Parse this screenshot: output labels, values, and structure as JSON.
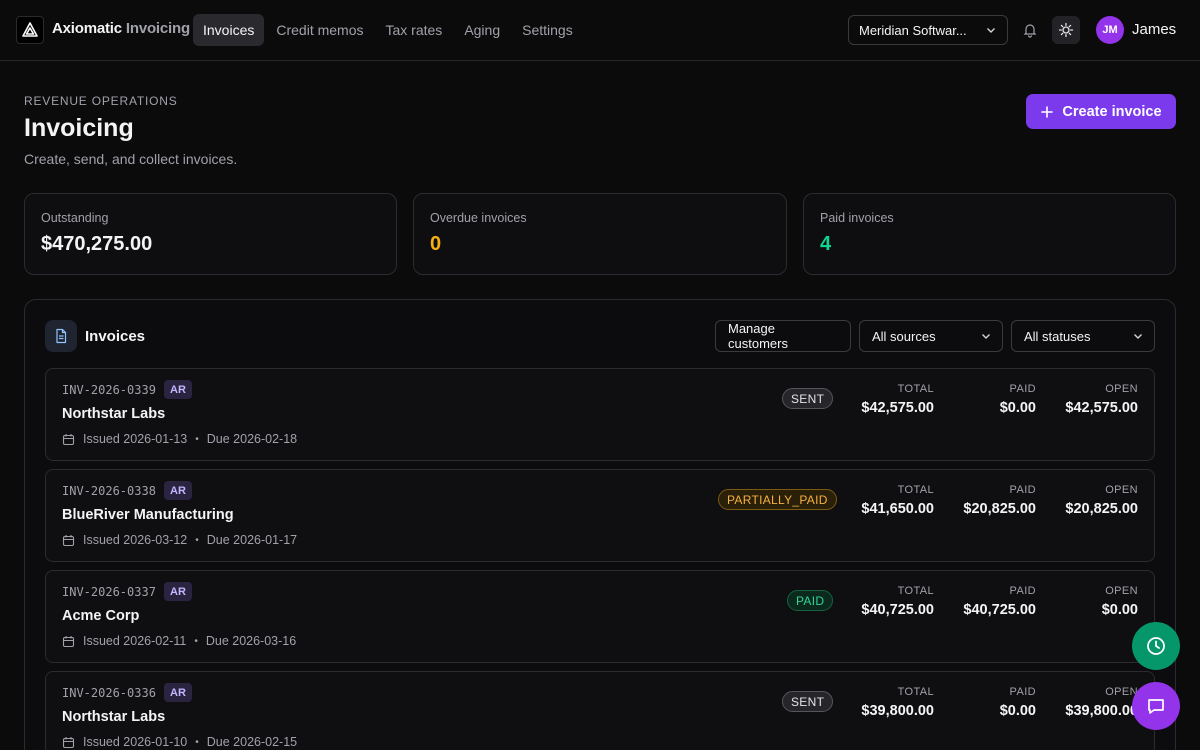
{
  "app": {
    "brand_primary": "Axiomatic",
    "brand_secondary": "Invoicing"
  },
  "nav": [
    {
      "label": "Invoices",
      "active": true
    },
    {
      "label": "Credit memos",
      "active": false
    },
    {
      "label": "Tax rates",
      "active": false
    },
    {
      "label": "Aging",
      "active": false
    },
    {
      "label": "Settings",
      "active": false
    }
  ],
  "org_select": {
    "value": "Meridian Softwar..."
  },
  "user": {
    "initials": "JM",
    "name": "James"
  },
  "header": {
    "eyebrow": "REVENUE OPERATIONS",
    "title": "Invoicing",
    "subtitle": "Create, send, and collect invoices.",
    "create_label": "Create invoice"
  },
  "stats": [
    {
      "label": "Outstanding",
      "value": "$470,275.00",
      "color": "#f4f4f5"
    },
    {
      "label": "Overdue invoices",
      "value": "0",
      "color": "#f5b013"
    },
    {
      "label": "Paid invoices",
      "value": "4",
      "color": "#10d38e"
    }
  ],
  "panel": {
    "title": "Invoices",
    "manage_label": "Manage customers",
    "sources_value": "All sources",
    "statuses_value": "All statuses"
  },
  "columns": {
    "total": "TOTAL",
    "paid": "PAID",
    "open": "OPEN"
  },
  "invoices": [
    {
      "number": "INV-2026-0339",
      "type": "AR",
      "customer": "Northstar Labs",
      "issued": "Issued 2026-01-13",
      "due": "Due 2026-02-18",
      "status": "SENT",
      "total": "$42,575.00",
      "paid": "$0.00",
      "open": "$42,575.00"
    },
    {
      "number": "INV-2026-0338",
      "type": "AR",
      "customer": "BlueRiver Manufacturing",
      "issued": "Issued 2026-03-12",
      "due": "Due 2026-01-17",
      "status": "PARTIALLY_PAID",
      "total": "$41,650.00",
      "paid": "$20,825.00",
      "open": "$20,825.00"
    },
    {
      "number": "INV-2026-0337",
      "type": "AR",
      "customer": "Acme Corp",
      "issued": "Issued 2026-02-11",
      "due": "Due 2026-03-16",
      "status": "PAID",
      "total": "$40,725.00",
      "paid": "$40,725.00",
      "open": "$0.00"
    },
    {
      "number": "INV-2026-0336",
      "type": "AR",
      "customer": "Northstar Labs",
      "issued": "Issued 2026-01-10",
      "due": "Due 2026-02-15",
      "status": "SENT",
      "total": "$39,800.00",
      "paid": "$0.00",
      "open": "$39,800.00"
    }
  ],
  "colors": {
    "accent": "#7c3aed",
    "success": "#059669",
    "chat": "#9333ea"
  }
}
